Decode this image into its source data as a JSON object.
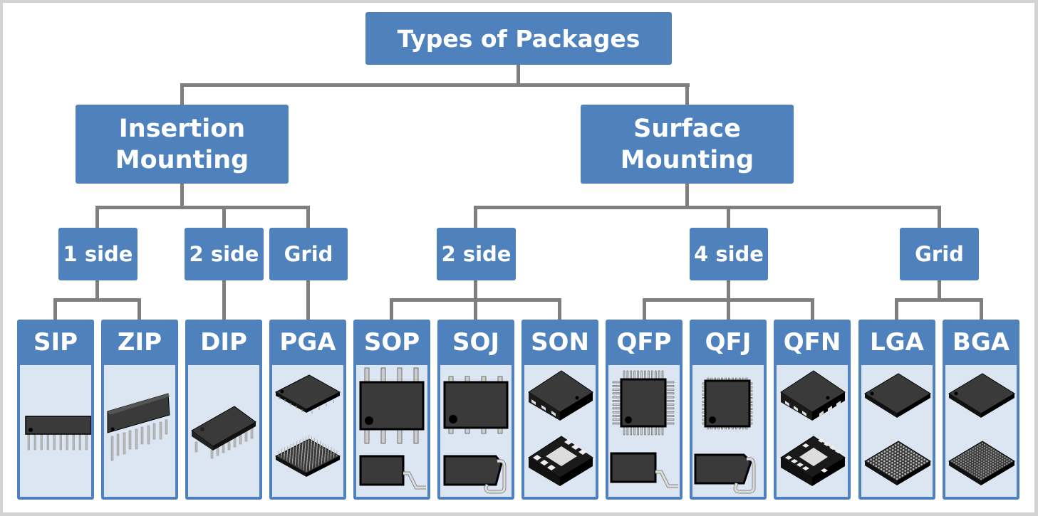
{
  "diagram": {
    "root": "Types of Packages",
    "categories": [
      {
        "line1": "Insertion",
        "line2": "Mounting"
      },
      {
        "line1": "Surface",
        "line2": "Mounting"
      }
    ],
    "subgroups": [
      "1 side",
      "2 side",
      "Grid",
      "2 side",
      "4 side",
      "Grid"
    ],
    "packages": [
      {
        "name": "SIP",
        "icon": "sip-package-icon"
      },
      {
        "name": "ZIP",
        "icon": "zip-package-icon"
      },
      {
        "name": "DIP",
        "icon": "dip-package-icon"
      },
      {
        "name": "PGA",
        "icon": "pga-package-icon"
      },
      {
        "name": "SOP",
        "icon": "sop-package-icon"
      },
      {
        "name": "SOJ",
        "icon": "soj-package-icon"
      },
      {
        "name": "SON",
        "icon": "son-package-icon"
      },
      {
        "name": "QFP",
        "icon": "qfp-package-icon"
      },
      {
        "name": "QFJ",
        "icon": "qfj-package-icon"
      },
      {
        "name": "QFN",
        "icon": "qfn-package-icon"
      },
      {
        "name": "LGA",
        "icon": "lga-package-icon"
      },
      {
        "name": "BGA",
        "icon": "bga-package-icon"
      }
    ],
    "colors": {
      "box": "#4f81bd",
      "connector": "#7f7f7f",
      "panel": "#dce6f2",
      "chip": "#3a3a3a"
    }
  }
}
